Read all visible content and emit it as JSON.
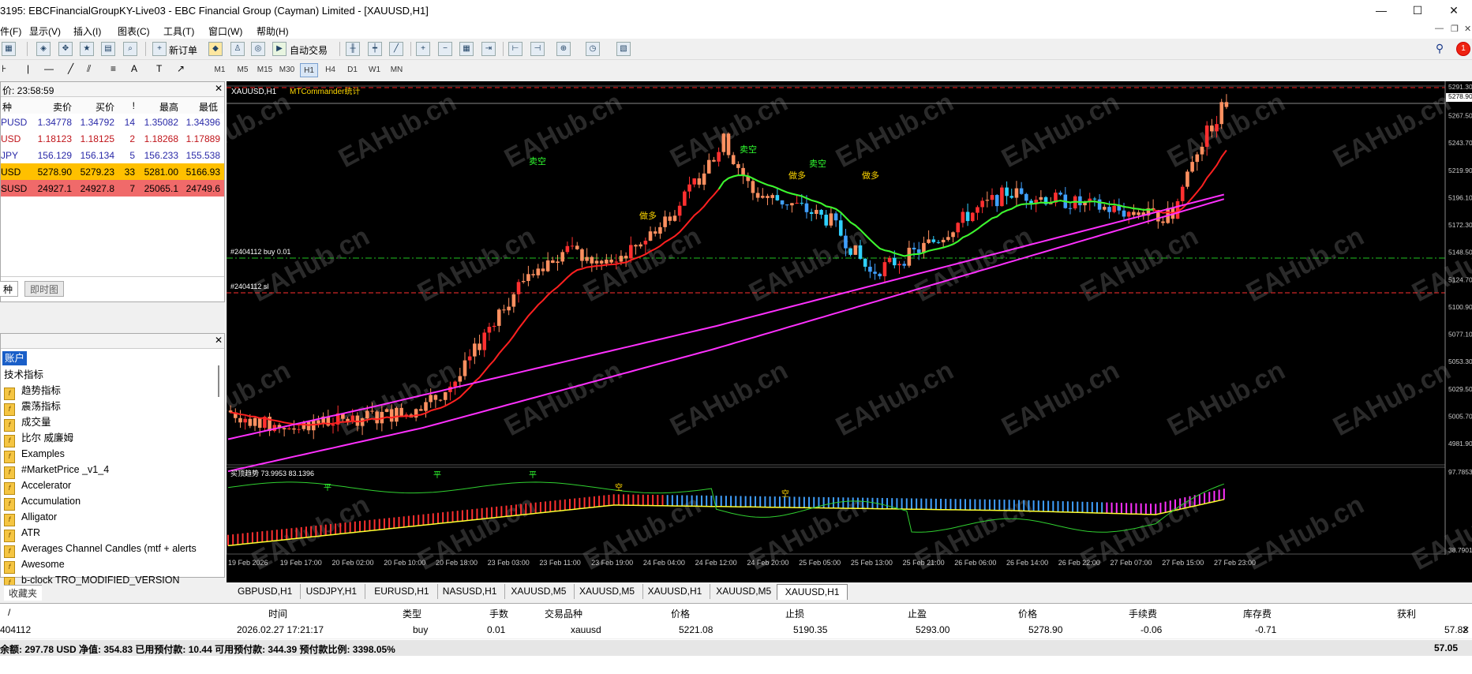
{
  "window": {
    "title": "3195: EBCFinancialGroupKY-Live03 - EBC Financial Group (Cayman) Limited - [XAUUSD,H1]",
    "minimize": "—",
    "maximize": "☐",
    "close": "✕"
  },
  "menu": [
    "件(F)",
    "显示(V)",
    "插入(I)",
    "图表(C)",
    "工具(T)",
    "窗口(W)",
    "帮助(H)"
  ],
  "toolbar": {
    "new_order": "新订单",
    "auto_trading": "自动交易"
  },
  "timeframes": [
    "M1",
    "M5",
    "M15",
    "M30",
    "H1",
    "H4",
    "D1",
    "W1",
    "MN"
  ],
  "active_timeframe": "H1",
  "market_watch": {
    "time_label": "价: 23:58:59",
    "headers": [
      "种",
      "卖价",
      "买价",
      "!",
      "最高",
      "最低"
    ],
    "rows": [
      {
        "symbol": "PUSD",
        "bid": "1.34778",
        "ask": "1.34792",
        "spread": "14",
        "high": "1.35082",
        "low": "1.34396",
        "color": "#2a2aa8",
        "bg": "#ffffff"
      },
      {
        "symbol": "USD",
        "bid": "1.18123",
        "ask": "1.18125",
        "spread": "2",
        "high": "1.18268",
        "low": "1.17889",
        "color": "#c0141a",
        "bg": "#ffffff"
      },
      {
        "symbol": "JPY",
        "bid": "156.129",
        "ask": "156.134",
        "spread": "5",
        "high": "156.233",
        "low": "155.538",
        "color": "#2a2aa8",
        "bg": "#ffffff"
      },
      {
        "symbol": "USD",
        "bid": "5278.90",
        "ask": "5279.23",
        "spread": "33",
        "high": "5281.00",
        "low": "5166.93",
        "color": "#000000",
        "bg": "#ffc000"
      },
      {
        "symbol": "SUSD",
        "bid": "24927.1",
        "ask": "24927.8",
        "spread": "7",
        "high": "25065.1",
        "low": "24749.6",
        "color": "#000000",
        "bg": "#f06a6a"
      }
    ],
    "tabs": [
      "种",
      "即时图"
    ]
  },
  "navigator": {
    "root": "账户",
    "items": [
      "技术指标",
      "趋势指标",
      "震荡指标",
      "成交量",
      "比尔 威廉姆",
      "Examples",
      "#MarketPrice _v1_4",
      "Accelerator",
      "Accumulation",
      "Alligator",
      "ATR",
      "Averages Channel Candles  (mtf + alerts",
      "Awesome",
      "b-clock TRO_MODIFIED_VERSION"
    ],
    "tab": "收藏夹"
  },
  "chart": {
    "symbol_label": "XAUUSD,H1",
    "indicator_label": "MTCommander统计",
    "order_line_label": "#2404112 buy 0.01",
    "sl_line_label": "#2404112 sl",
    "sub_indicator_label": "买顶趋势 73.9953 83.1396",
    "price_axis": [
      "5291.30",
      "5278.90",
      "5267.50",
      "5243.70",
      "5219.90",
      "5196.10",
      "5172.30",
      "5148.50",
      "5124.70",
      "5100.90",
      "5077.10",
      "5053.30",
      "5029.50",
      "5005.70",
      "4981.90"
    ],
    "sub_axis": [
      "97.7853",
      "38.7901"
    ],
    "time_axis": [
      "19 Feb 2026",
      "19 Feb 17:00",
      "20 Feb 02:00",
      "20 Feb 10:00",
      "20 Feb 18:00",
      "23 Feb 03:00",
      "23 Feb 11:00",
      "23 Feb 19:00",
      "24 Feb 04:00",
      "24 Feb 12:00",
      "24 Feb 20:00",
      "25 Feb 05:00",
      "25 Feb 13:00",
      "25 Feb 21:00",
      "26 Feb 06:00",
      "26 Feb 14:00",
      "26 Feb 22:00",
      "27 Feb 07:00",
      "27 Feb 15:00",
      "27 Feb 23:00"
    ],
    "signals": {
      "sell": "卖空",
      "buy": "做多",
      "flat": "平",
      "short": "空"
    },
    "watermark": "EAHub.cn",
    "colors": {
      "bull": "#ff3030",
      "bear": "#40a0ff",
      "bull_light": "#ff9060",
      "ma_red": "#ff2020",
      "ma_green": "#30ff30",
      "band": "#ff30ff",
      "buy_line": "#20c020",
      "sl_line": "#ff3030"
    }
  },
  "chart_tabs": [
    "GBPUSD,H1",
    "USDJPY,H1",
    "EURUSD,H1",
    "NASUSD,H1",
    "XAUUSD,M5",
    "XAUUSD,M5",
    "XAUUSD,H1",
    "XAUUSD,M5",
    "XAUUSD,H1"
  ],
  "active_chart_tab": 8,
  "terminal": {
    "headers": [
      "/",
      "时间",
      "类型",
      "手数",
      "交易品种",
      "价格",
      "止损",
      "止盈",
      "价格",
      "手续费",
      "库存费",
      "获利"
    ],
    "row": [
      "404112",
      "2026.02.27 17:21:17",
      "buy",
      "0.01",
      "xauusd",
      "5221.08",
      "5190.35",
      "5293.00",
      "5278.90",
      "-0.06",
      "-0.71",
      "57.82"
    ],
    "balance_text": "余额: 297.78 USD  净值: 354.83  已用预付款: 10.44  可用预付款: 344.39  预付款比例: 3398.05%",
    "balance_profit": "57.05"
  }
}
